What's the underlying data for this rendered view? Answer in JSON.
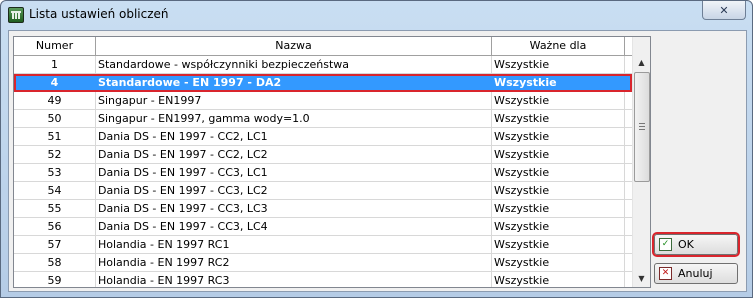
{
  "window": {
    "title": "Lista ustawień obliczeń",
    "close_glyph": "✕"
  },
  "table": {
    "columns": [
      "Numer",
      "Nazwa",
      "Ważne dla"
    ],
    "rows": [
      {
        "num": "1",
        "name": "Standardowe - współczynniki bezpieczeństwa",
        "valid": "Wszystkie"
      },
      {
        "num": "4",
        "name": "Standardowe - EN 1997 - DA2",
        "valid": "Wszystkie",
        "selected": true
      },
      {
        "num": "49",
        "name": "Singapur - EN1997",
        "valid": "Wszystkie"
      },
      {
        "num": "50",
        "name": "Singapur - EN1997, gamma wody=1.0",
        "valid": "Wszystkie"
      },
      {
        "num": "51",
        "name": "Dania DS - EN 1997 - CC2, LC1",
        "valid": "Wszystkie"
      },
      {
        "num": "52",
        "name": "Dania DS - EN 1997 - CC2, LC2",
        "valid": "Wszystkie"
      },
      {
        "num": "53",
        "name": "Dania DS - EN 1997 - CC3, LC1",
        "valid": "Wszystkie"
      },
      {
        "num": "54",
        "name": "Dania DS - EN 1997 - CC3, LC2",
        "valid": "Wszystkie"
      },
      {
        "num": "55",
        "name": "Dania DS - EN 1997 - CC3, LC3",
        "valid": "Wszystkie"
      },
      {
        "num": "56",
        "name": "Dania DS - EN 1997 - CC3, LC4",
        "valid": "Wszystkie"
      },
      {
        "num": "57",
        "name": "Holandia - EN 1997 RC1",
        "valid": "Wszystkie"
      },
      {
        "num": "58",
        "name": "Holandia - EN 1997 RC2",
        "valid": "Wszystkie"
      },
      {
        "num": "59",
        "name": "Holandia - EN 1997 RC3",
        "valid": "Wszystkie"
      }
    ]
  },
  "scrollbar": {
    "up_glyph": "▲",
    "down_glyph": "▼"
  },
  "buttons": {
    "ok_label": "OK",
    "ok_glyph": "✓",
    "cancel_label": "Anuluj",
    "cancel_glyph": "✕"
  },
  "colors": {
    "selection": "#3399ff",
    "highlight_outline": "#d9252d"
  }
}
